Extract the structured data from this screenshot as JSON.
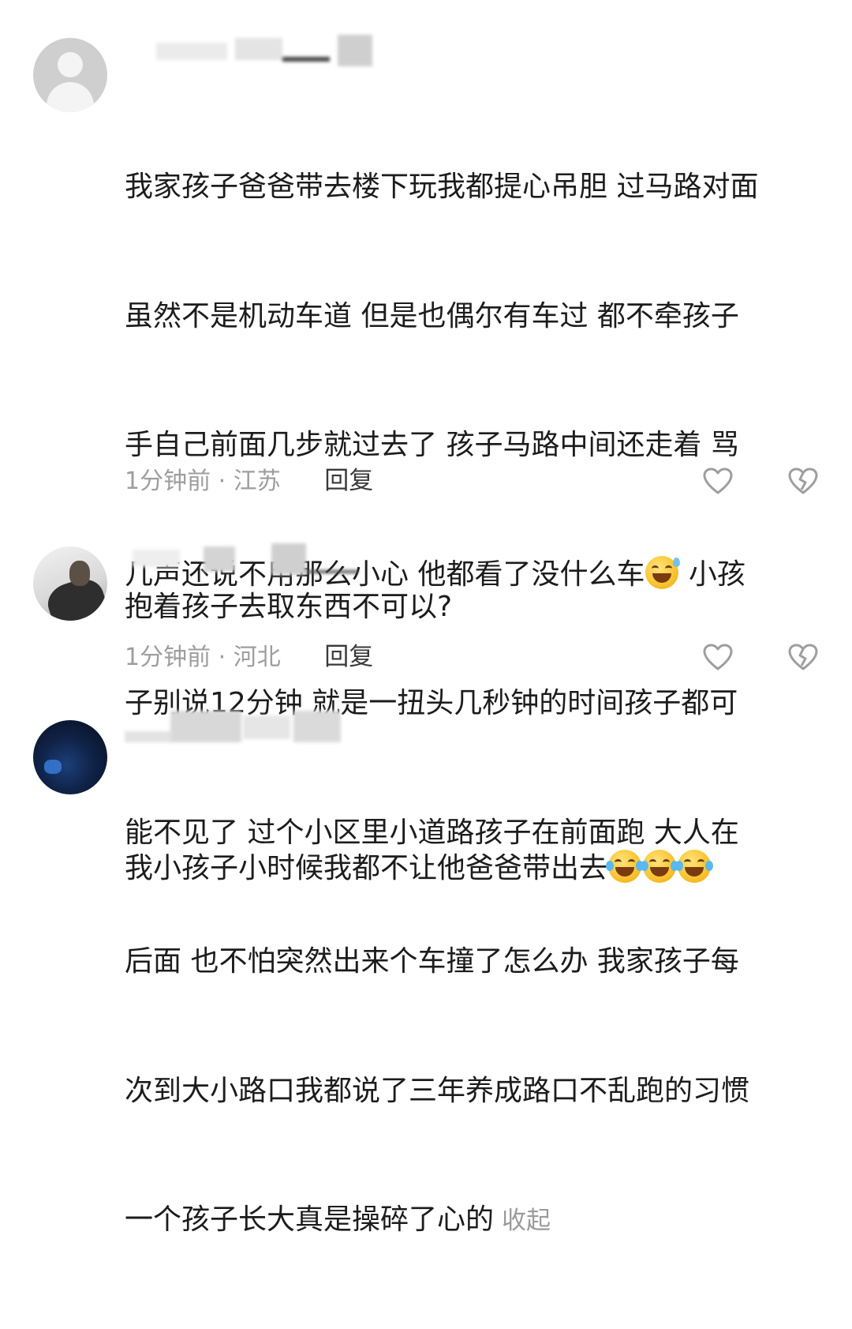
{
  "comments": [
    {
      "lines": [
        "我家孩子爸爸带去楼下玩我都提心吊胆 过马路对面",
        "虽然不是机动车道 但是也偶尔有车过 都不牵孩子",
        "手自己前面几步就过去了 孩子马路中间还走着 骂",
        "几声还说不用那么小心 他都看了没什么车",
        " 小孩",
        "子别说12分钟 就是一扭头几秒钟的时间孩子都可",
        "能不见了  过个小区里小道路孩子在前面跑 大人在",
        "后面 也不怕突然出来个车撞了怎么办  我家孩子每",
        "次到大小路口我都说了三年养成路口不乱跑的习惯",
        "一个孩子长大真是操碎了心的"
      ],
      "collapse_label": "收起",
      "time_location": "1分钟前 · 江苏",
      "reply_label": "回复"
    },
    {
      "text": "抱着孩子去取东西不可以?",
      "time_location": "1分钟前 · 河北",
      "reply_label": "回复"
    },
    {
      "text": "我小孩子小时候我都不让他爸爸带出去"
    }
  ],
  "icons": {
    "like": "heart-outline-icon",
    "dislike": "broken-heart-icon",
    "emoji_sweat": "grinning-sweat-emoji",
    "emoji_laugh": "rolling-laughing-emoji"
  }
}
